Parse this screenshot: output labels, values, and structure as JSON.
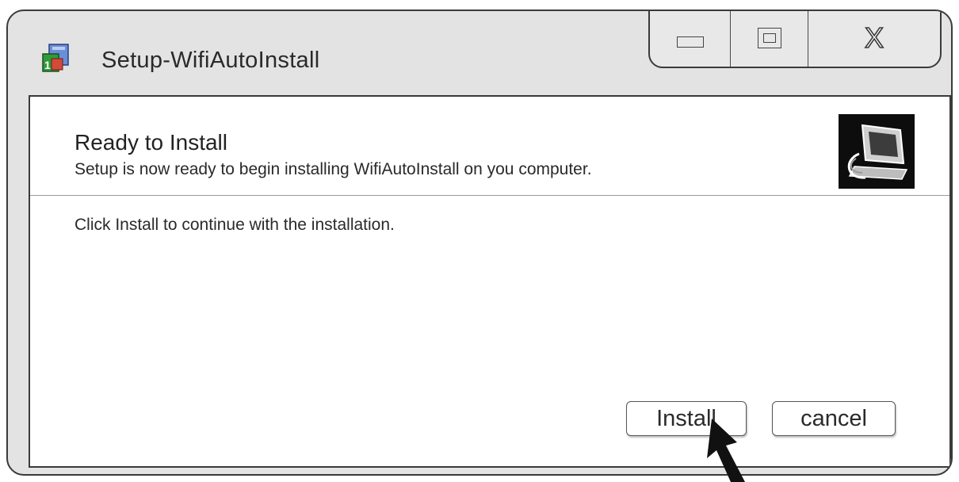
{
  "window": {
    "title": "Setup-WifiAutoInstall",
    "app_icon": "setup-package-icon",
    "caption_buttons": {
      "minimize_icon": "minimize-icon",
      "maximize_icon": "maximize-icon",
      "close_label": "X"
    }
  },
  "header": {
    "title": "Ready to Install",
    "subtitle": "Setup is now ready to begin installing WifiAutoInstall on you computer.",
    "image_icon": "computer-install-icon"
  },
  "body": {
    "instruction": "Click Install to continue with the installation."
  },
  "buttons": {
    "install_label": "Install",
    "cancel_label": "cancel"
  },
  "overlay": {
    "pointer_icon": "arrow-pointer-icon"
  },
  "colors": {
    "frame": "#3a3a3a",
    "window_bg": "#e3e3e3",
    "panel_bg": "#ffffff",
    "header_image_bg": "#0d0d0d"
  }
}
